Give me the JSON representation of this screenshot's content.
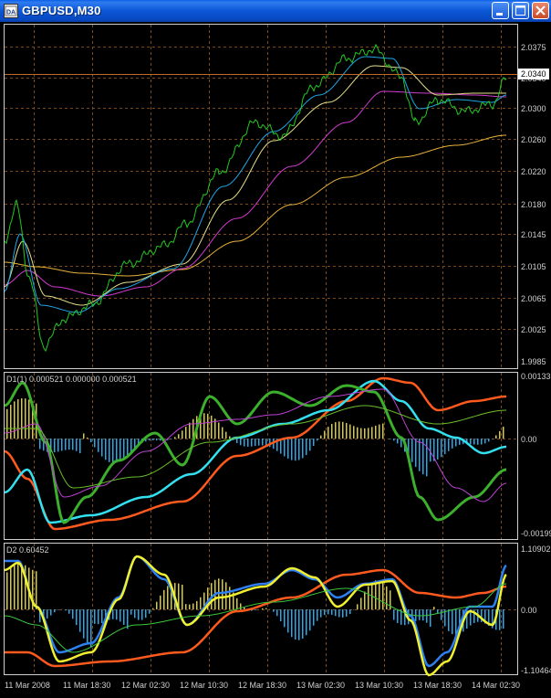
{
  "window": {
    "title": "GBPUSD,M30",
    "buttons": [
      "minimize",
      "maximize",
      "close"
    ]
  },
  "colors": {
    "background": "#000000",
    "grid": "#7a4a1c",
    "axis": "#cfcfcf",
    "price_line": "#00c800",
    "current_price_line": "#c06a2a",
    "current_price_box": "#ffffff"
  },
  "main_panel": {
    "y_ticks": [
      "2.0375",
      "2.0340",
      "2.0300",
      "2.0260",
      "2.0220",
      "2.0180",
      "2.0145",
      "2.0105",
      "2.0065",
      "2.0025",
      "1.9985"
    ],
    "current_price": "2.0340"
  },
  "indicator1": {
    "label": "D1(1) 0.000521 0.000000 0.000521",
    "y_ticks": [
      "0.00133",
      "0.00",
      "-0.00199"
    ]
  },
  "indicator2": {
    "label": "D2 0.60452",
    "y_ticks": [
      "1.10902",
      "0.00",
      "-1.10464"
    ]
  },
  "x_axis": {
    "labels": [
      "11 Mar 2008",
      "11 Mar 18:30",
      "12 Mar 02:30",
      "12 Mar 10:30",
      "12 Mar 18:30",
      "13 Mar 02:30",
      "13 Mar 10:30",
      "13 Mar 18:30",
      "14 Mar 02:30"
    ]
  }
}
